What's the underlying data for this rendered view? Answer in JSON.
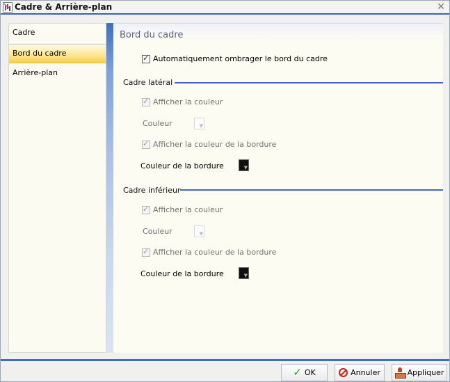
{
  "window": {
    "title": "Cadre & Arrière-plan"
  },
  "nav": {
    "items": [
      {
        "label": "Cadre",
        "selected": false
      },
      {
        "label": "Bord du cadre",
        "selected": true
      },
      {
        "label": "Arrière-plan",
        "selected": false
      }
    ]
  },
  "content": {
    "section_title": "Bord du cadre",
    "auto_shadow": {
      "label": "Automatiquement ombrager le bord du cadre",
      "checked": true
    },
    "lateral": {
      "title": "Cadre latéral",
      "show_color": {
        "label": "Afficher la couleur",
        "checked": true,
        "enabled": false
      },
      "color_label": "Couleur",
      "color_value": "#fcfcfc",
      "show_border_color": {
        "label": "Afficher la couleur de la bordure",
        "checked": true,
        "enabled": false
      },
      "border_color_label": "Couleur de la bordure",
      "border_color_value": "#101010"
    },
    "bottom": {
      "title": "Cadre inférieur",
      "show_color": {
        "label": "Afficher la couleur",
        "checked": true,
        "enabled": false
      },
      "color_label": "Couleur",
      "color_value": "#fcfcfc",
      "show_border_color": {
        "label": "Afficher la couleur de la bordure",
        "checked": true,
        "enabled": false
      },
      "border_color_label": "Couleur de la bordure",
      "border_color_value": "#101010"
    }
  },
  "buttons": {
    "ok": {
      "label": "OK",
      "icon": "check-icon"
    },
    "cancel": {
      "label": "Annuler",
      "icon": "cancel-icon"
    },
    "apply": {
      "label": "Appliquer",
      "icon": "stamp-icon"
    }
  },
  "colors": {
    "accent": "#3d6cc0",
    "selected_nav": "#f7cf4a"
  }
}
